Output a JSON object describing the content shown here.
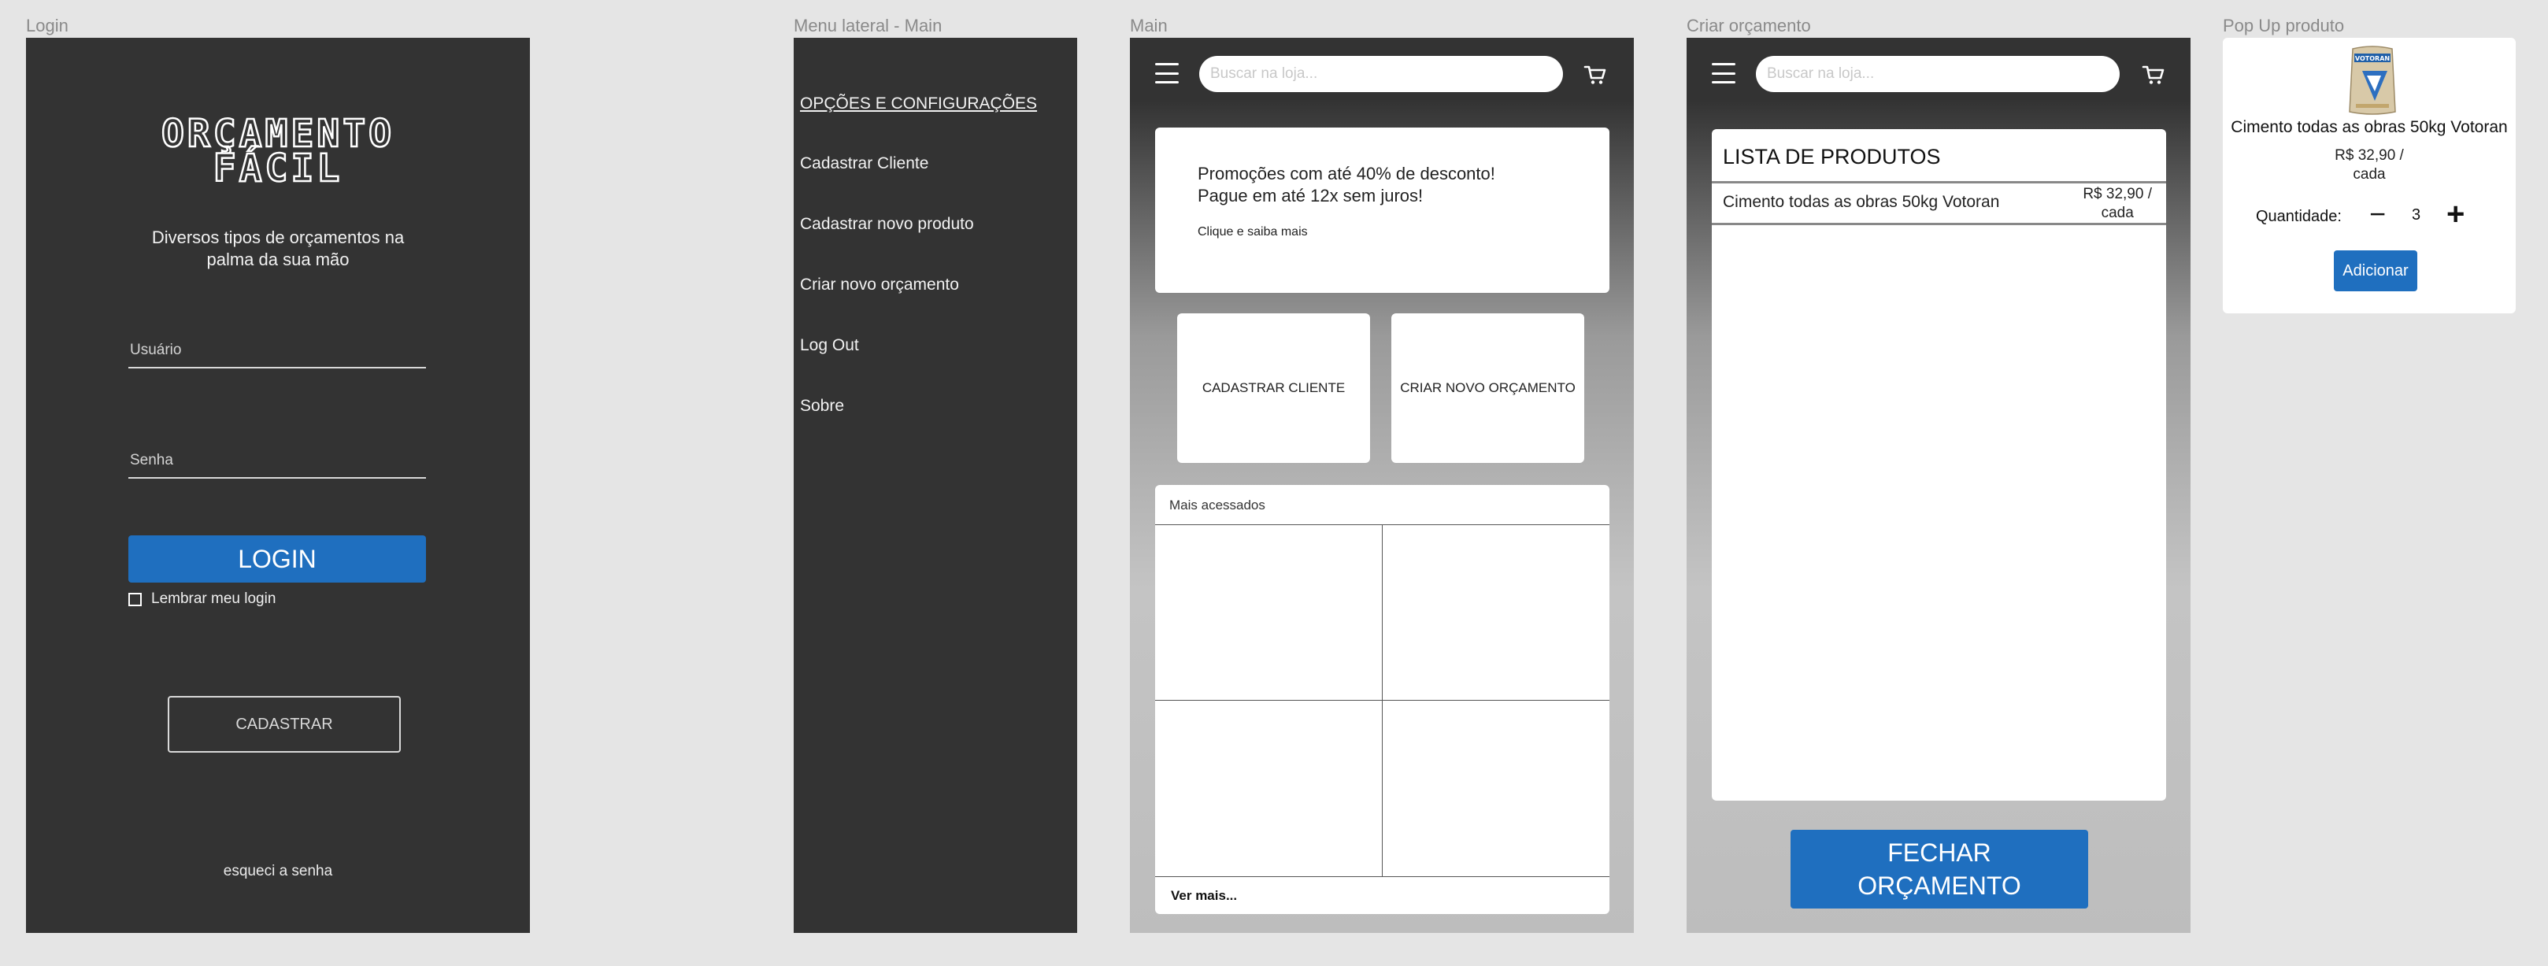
{
  "frame_labels": {
    "login": "Login",
    "menu": "Menu lateral - Main",
    "main": "Main",
    "criar": "Criar orçamento",
    "popup": "Pop Up produto"
  },
  "login": {
    "logo_line1": "ORÇAMENTO",
    "logo_line2": "FÁCIL",
    "subtitle": "Diversos tipos de orçamentos na palma da sua mão",
    "user_placeholder": "Usuário",
    "pass_placeholder": "Senha",
    "login_button": "LOGIN",
    "remember_label": "Lembrar meu login",
    "register_button": "CADASTRAR",
    "forgot_link": "esqueci a senha"
  },
  "menu": {
    "header": "OPÇÕES E CONFIGURAÇÕES",
    "items": [
      {
        "label": "Cadastrar Cliente"
      },
      {
        "label": "Cadastrar novo produto"
      },
      {
        "label": "Criar novo orçamento"
      },
      {
        "label": "Log Out"
      },
      {
        "label": "Sobre"
      }
    ]
  },
  "main": {
    "search_placeholder": "Buscar na loja...",
    "promo_line1": "Promoções com até 40% de desconto!",
    "promo_line2": "Pague em até 12x sem juros!",
    "promo_link": "Clique e saiba mais",
    "card_cliente": "CADASTRAR CLIENTE",
    "card_orcamento": "CRIAR NOVO ORÇAMENTO",
    "mais_title": "Mais acessados",
    "ver_mais": "Ver mais..."
  },
  "criar": {
    "search_placeholder": "Buscar na loja...",
    "lista_title": "LISTA DE PRODUTOS",
    "products": [
      {
        "name": "Cimento todas as obras 50kg Votoran",
        "price": "R$ 32,90 /",
        "unit": "cada"
      }
    ],
    "fechar_line1": "FECHAR",
    "fechar_line2": "ORÇAMENTO"
  },
  "popup": {
    "product_name": "Cimento todas as obras 50kg Votoran",
    "price": "R$ 32,90 /",
    "unit": "cada",
    "qty_label": "Quantidade:",
    "qty_value": "3",
    "add_button": "Adicionar",
    "bag_brand": "VOTORAN"
  },
  "colors": {
    "primary_blue": "#1f6fbf",
    "dark_bg": "#333333",
    "canvas": "#e5e5e5"
  }
}
